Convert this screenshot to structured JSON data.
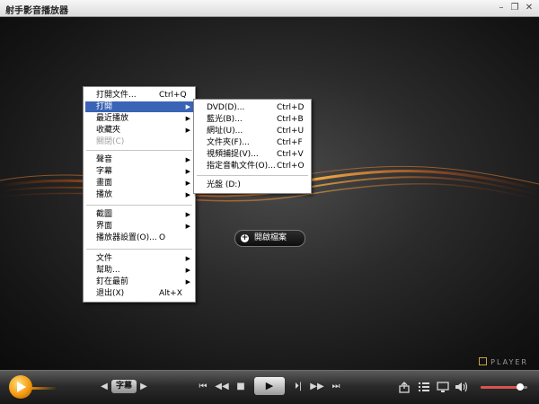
{
  "window": {
    "title": "射手影音播放器",
    "minimize": "–",
    "restore": "❐",
    "close": "✕"
  },
  "center_button": {
    "label": "開啟檔案"
  },
  "watermark": "PLAYER",
  "main_menu": [
    {
      "label": "打開文件...",
      "shortcut": "Ctrl+Q"
    },
    {
      "label": "打開",
      "submenu": true,
      "selected": true
    },
    {
      "label": "最近播放",
      "submenu": true
    },
    {
      "label": "收藏夾",
      "submenu": true
    },
    {
      "label": "關閉(C)",
      "disabled": true
    },
    {
      "label": "聲音",
      "submenu": true
    },
    {
      "label": "字幕",
      "submenu": true
    },
    {
      "label": "畫面",
      "submenu": true
    },
    {
      "label": "播放",
      "submenu": true
    },
    {
      "label": "截圖",
      "submenu": true
    },
    {
      "label": "界面",
      "submenu": true
    },
    {
      "label": "播放器設置(O)...",
      "shortcut": "O"
    },
    {
      "label": "文件",
      "submenu": true
    },
    {
      "label": "幫助...",
      "submenu": true
    },
    {
      "label": "釘在最前",
      "submenu": true
    },
    {
      "label": "退出(X)",
      "shortcut": "Alt+X"
    }
  ],
  "sub_menu": [
    {
      "label": "DVD(D)...",
      "shortcut": "Ctrl+D"
    },
    {
      "label": "藍光(B)...",
      "shortcut": "Ctrl+B"
    },
    {
      "label": "網址(U)...",
      "shortcut": "Ctrl+U"
    },
    {
      "label": "文件夾(F)...",
      "shortcut": "Ctrl+F"
    },
    {
      "label": "視頻捕捉(V)...",
      "shortcut": "Ctrl+V"
    },
    {
      "label": "指定音軌文件(O)...",
      "shortcut": "Ctrl+O"
    },
    {
      "label": "光盤 (D:)"
    }
  ],
  "controls": {
    "subtitle_label": "字幕",
    "prev_sub": "◀",
    "next_sub": "▶",
    "prev_track": "⏮",
    "rewind": "◀◀",
    "stop": "■",
    "play": "▶",
    "step": "⏵|",
    "forward": "▶▶",
    "next_track": "⏭",
    "volume_level": 0.85
  },
  "colors": {
    "menu_highlight": "#3a64b6",
    "accent_orange": "#f59a12",
    "volume_fill": "#d9534f"
  }
}
